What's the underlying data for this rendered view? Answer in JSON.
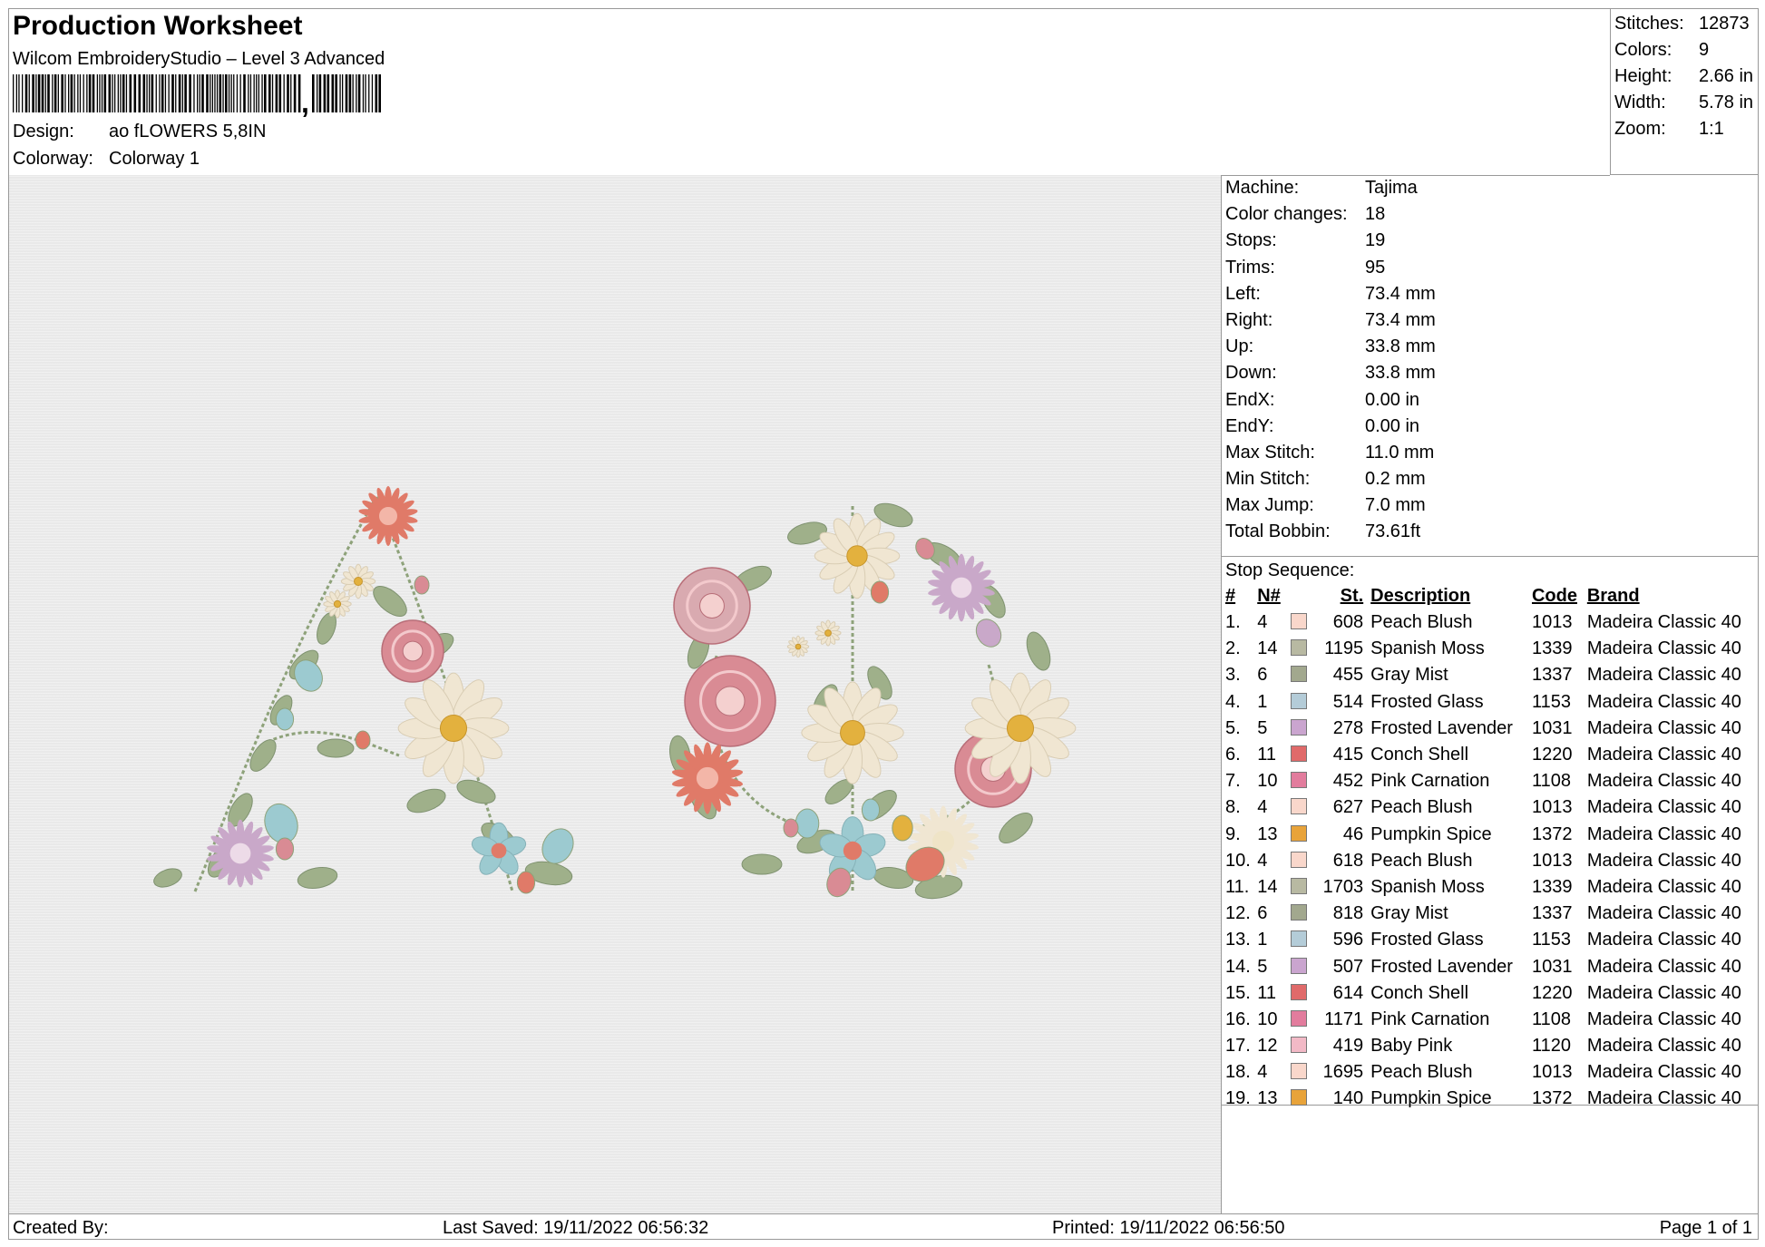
{
  "header": {
    "title": "Production Worksheet",
    "software": "Wilcom EmbroideryStudio – Level 3 Advanced",
    "design_label": "Design:",
    "design_value": "ao fLOWERS 5,8IN",
    "colorway_label": "Colorway:",
    "colorway_value": "Colorway 1"
  },
  "stats": [
    {
      "label": "Stitches:",
      "value": "12873"
    },
    {
      "label": "Colors:",
      "value": "9"
    },
    {
      "label": "Height:",
      "value": "2.66 in"
    },
    {
      "label": "Width:",
      "value": "5.78 in"
    },
    {
      "label": "Zoom:",
      "value": "1:1"
    }
  ],
  "machine_info": [
    {
      "label": "Machine:",
      "value": "Tajima"
    },
    {
      "label": "Color changes:",
      "value": "18"
    },
    {
      "label": "Stops:",
      "value": "19"
    },
    {
      "label": "Trims:",
      "value": "95"
    },
    {
      "label": "Left:",
      "value": "73.4 mm"
    },
    {
      "label": "Right:",
      "value": "73.4 mm"
    },
    {
      "label": "Up:",
      "value": "33.8 mm"
    },
    {
      "label": "Down:",
      "value": "33.8 mm"
    },
    {
      "label": "EndX:",
      "value": "0.00 in"
    },
    {
      "label": "EndY:",
      "value": "0.00 in"
    },
    {
      "label": "Max Stitch:",
      "value": "11.0 mm"
    },
    {
      "label": "Min Stitch:",
      "value": "0.2 mm"
    },
    {
      "label": "Max Jump:",
      "value": "7.0 mm"
    },
    {
      "label": "Total Bobbin:",
      "value": "73.61ft"
    }
  ],
  "stop_sequence": {
    "title": "Stop Sequence:",
    "headers": {
      "idx": "#",
      "n": "N#",
      "st": "St.",
      "desc": "Description",
      "code": "Code",
      "brand": "Brand"
    },
    "rows": [
      {
        "idx": "1.",
        "n": "4",
        "color": "#f9d7cb",
        "st": "608",
        "desc": "Peach Blush",
        "code": "1013",
        "brand": "Madeira Classic 40"
      },
      {
        "idx": "2.",
        "n": "14",
        "color": "#b8b9a2",
        "st": "1195",
        "desc": "Spanish Moss",
        "code": "1339",
        "brand": "Madeira Classic 40"
      },
      {
        "idx": "3.",
        "n": "6",
        "color": "#a2a88e",
        "st": "455",
        "desc": "Gray Mist",
        "code": "1337",
        "brand": "Madeira Classic 40"
      },
      {
        "idx": "4.",
        "n": "1",
        "color": "#b4ccd8",
        "st": "514",
        "desc": "Frosted Glass",
        "code": "1153",
        "brand": "Madeira Classic 40"
      },
      {
        "idx": "5.",
        "n": "5",
        "color": "#caa5cf",
        "st": "278",
        "desc": "Frosted Lavender",
        "code": "1031",
        "brand": "Madeira Classic 40"
      },
      {
        "idx": "6.",
        "n": "11",
        "color": "#e06a6a",
        "st": "415",
        "desc": "Conch Shell",
        "code": "1220",
        "brand": "Madeira Classic 40"
      },
      {
        "idx": "7.",
        "n": "10",
        "color": "#e27c9d",
        "st": "452",
        "desc": "Pink Carnation",
        "code": "1108",
        "brand": "Madeira Classic 40"
      },
      {
        "idx": "8.",
        "n": "4",
        "color": "#f9d7cb",
        "st": "627",
        "desc": "Peach Blush",
        "code": "1013",
        "brand": "Madeira Classic 40"
      },
      {
        "idx": "9.",
        "n": "13",
        "color": "#e8a33a",
        "st": "46",
        "desc": "Pumpkin Spice",
        "code": "1372",
        "brand": "Madeira Classic 40"
      },
      {
        "idx": "10.",
        "n": "4",
        "color": "#f9d7cb",
        "st": "618",
        "desc": "Peach Blush",
        "code": "1013",
        "brand": "Madeira Classic 40"
      },
      {
        "idx": "11.",
        "n": "14",
        "color": "#b8b9a2",
        "st": "1703",
        "desc": "Spanish Moss",
        "code": "1339",
        "brand": "Madeira Classic 40"
      },
      {
        "idx": "12.",
        "n": "6",
        "color": "#a2a88e",
        "st": "818",
        "desc": "Gray Mist",
        "code": "1337",
        "brand": "Madeira Classic 40"
      },
      {
        "idx": "13.",
        "n": "1",
        "color": "#b4ccd8",
        "st": "596",
        "desc": "Frosted Glass",
        "code": "1153",
        "brand": "Madeira Classic 40"
      },
      {
        "idx": "14.",
        "n": "5",
        "color": "#caa5cf",
        "st": "507",
        "desc": "Frosted Lavender",
        "code": "1031",
        "brand": "Madeira Classic 40"
      },
      {
        "idx": "15.",
        "n": "11",
        "color": "#e06a6a",
        "st": "614",
        "desc": "Conch Shell",
        "code": "1220",
        "brand": "Madeira Classic 40"
      },
      {
        "idx": "16.",
        "n": "10",
        "color": "#e27c9d",
        "st": "1171",
        "desc": "Pink Carnation",
        "code": "1108",
        "brand": "Madeira Classic 40"
      },
      {
        "idx": "17.",
        "n": "12",
        "color": "#f2b9c6",
        "st": "419",
        "desc": "Baby Pink",
        "code": "1120",
        "brand": "Madeira Classic 40"
      },
      {
        "idx": "18.",
        "n": "4",
        "color": "#f9d7cb",
        "st": "1695",
        "desc": "Peach Blush",
        "code": "1013",
        "brand": "Madeira Classic 40"
      },
      {
        "idx": "19.",
        "n": "13",
        "color": "#e8a33a",
        "st": "140",
        "desc": "Pumpkin Spice",
        "code": "1372",
        "brand": "Madeira Classic 40"
      }
    ]
  },
  "footer": {
    "created_by": "Created By:",
    "last_saved": "Last Saved: 19/11/2022 06:56:32",
    "printed": "Printed: 19/11/2022 06:56:50",
    "page": "Page 1 of 1"
  },
  "design_colors": {
    "leaf": "#9fb08a",
    "peach": "#f0e6d2",
    "coral": "#e07a68",
    "rose": "#d98b94",
    "teal": "#9ccad0",
    "lavender": "#c9a8c9",
    "gold": "#e3b13e",
    "stem": "#8ea27a"
  }
}
